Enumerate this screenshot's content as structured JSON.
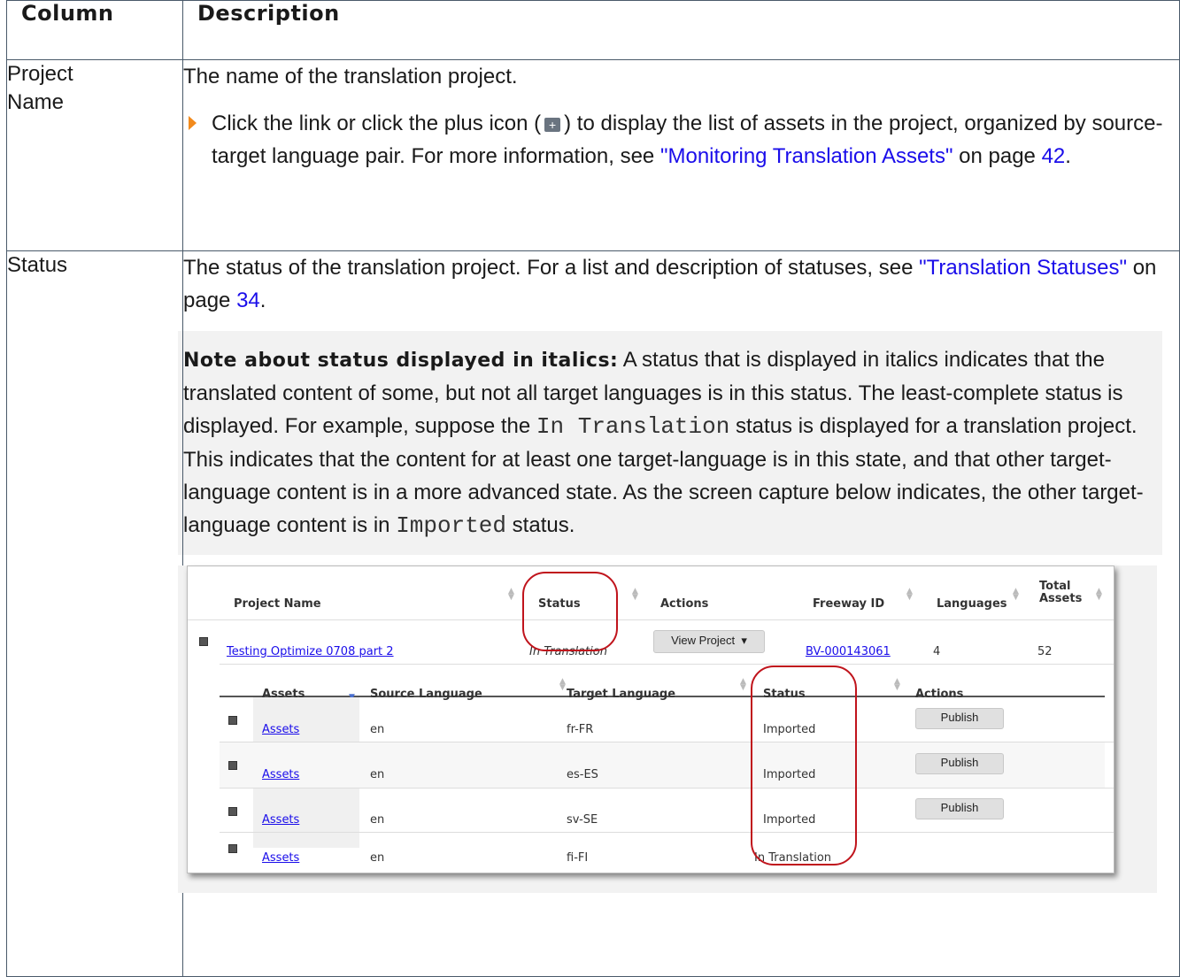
{
  "table": {
    "col_header": "Column",
    "desc_header": "Description"
  },
  "row1": {
    "name": "Project Name",
    "desc": "The name of the translation project.",
    "bullet_a": "Click the link or click the plus icon (",
    "bullet_b": ") to display the list of assets in the project, organized by source-target language pair. For more information, see ",
    "link": "\"Monitoring Translation Assets\"",
    "on_page": " on page ",
    "page": "42",
    "end": "."
  },
  "row2": {
    "name": "Status",
    "desc_a": "The status of the translation project. For a list and description of statuses, see ",
    "link": "\"Translation Statuses\"",
    "on_page": " on page ",
    "page": "34",
    "end": ".",
    "note_label": "Note about status displayed in italics:",
    "note_a": " A status that is displayed in italics indicates that the translated content of some, but not all target languages is in this status. The least-complete status is displayed. For example, suppose the ",
    "note_code1": "In Translation",
    "note_b": " status is displayed for a translation project. This indicates that the content for at least one target-language is in this state, and that other target-language content is in a more advanced state. As the screen capture below indicates, the other target-language content is in ",
    "note_code2": "Imported",
    "note_c": " status."
  },
  "screenshot": {
    "headers": {
      "project_name": "Project Name",
      "status": "Status",
      "actions": "Actions",
      "freeway_id": "Freeway ID",
      "languages": "Languages",
      "total_assets": "Total Assets"
    },
    "project": {
      "name": "Testing Optimize 0708 part 2",
      "status": "In Translation",
      "button": "View Project",
      "freeway_id": "BV-000143061",
      "languages": "4",
      "total_assets": "52"
    },
    "sub_headers": {
      "assets": "Assets",
      "source": "Source Language",
      "target": "Target Language",
      "status": "Status",
      "actions": "Actions"
    },
    "rows": [
      {
        "asset": "Assets",
        "source": "en",
        "target": "fr-FR",
        "status": "Imported",
        "action": "Publish"
      },
      {
        "asset": "Assets",
        "source": "en",
        "target": "es-ES",
        "status": "Imported",
        "action": "Publish"
      },
      {
        "asset": "Assets",
        "source": "en",
        "target": "sv-SE",
        "status": "Imported",
        "action": "Publish"
      },
      {
        "asset": "Assets",
        "source": "en",
        "target": "fi-FI",
        "status": "In Translation",
        "action": ""
      }
    ]
  }
}
